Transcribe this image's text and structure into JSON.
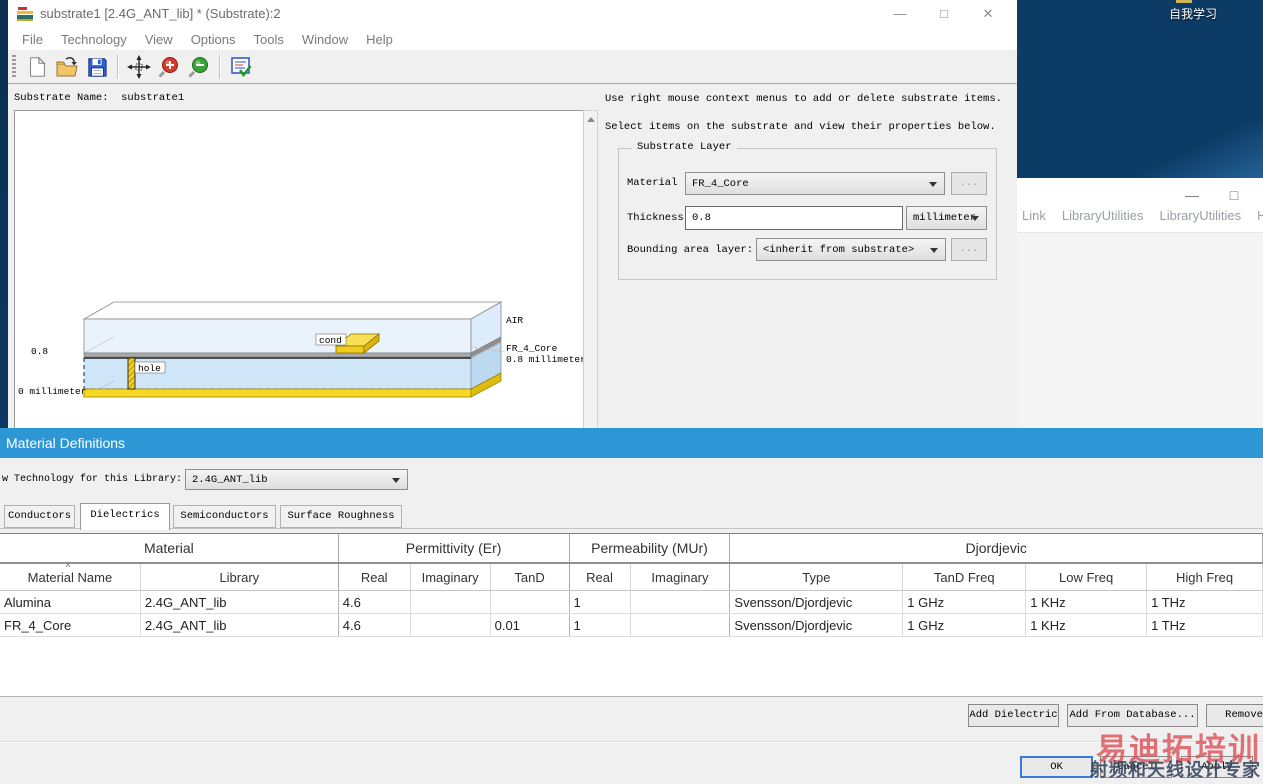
{
  "colors": {
    "dialog_titlebar": "#2d96d5",
    "desktop_blue_dark": "#0c3b66",
    "desktop_blue_light": "#2e6fa8",
    "focus_accent": "#3a7bd5",
    "watermark_red": "#db5058",
    "trace_yellow": "#f6d42e",
    "layer_blue": "#d6e9fb"
  },
  "desktop": {
    "icon_label": "自我学习"
  },
  "background_window": {
    "menus": [
      "Link",
      "LibraryUtilities",
      "LibraryUtilities",
      "He"
    ]
  },
  "substrate_window": {
    "title": "substrate1 [2.4G_ANT_lib] * (Substrate):2",
    "menus": [
      "File",
      "Technology",
      "View",
      "Options",
      "Tools",
      "Window",
      "Help"
    ],
    "toolbar_icons": [
      "new-file",
      "open",
      "save",
      "pan",
      "zoom-in",
      "zoom-out",
      "substrate-check"
    ],
    "substrate_name_label": "Substrate Name:",
    "substrate_name_value": "substrate1",
    "hints": [
      "Use right mouse context menus to add or delete substrate items.",
      "Select items on the substrate and view their properties below."
    ],
    "layer_group": {
      "title": "Substrate Layer",
      "material_label": "Material",
      "material_value": "FR_4_Core",
      "material_browse": "...",
      "thickness_label": "Thickness",
      "thickness_value": "0.8",
      "thickness_unit": "millimeter",
      "bounding_label": "Bounding area layer:",
      "bounding_value": "<inherit from substrate>",
      "bounding_browse": "..."
    },
    "preview_labels": {
      "air": "AIR",
      "cond": "cond",
      "hole": "hole",
      "top_height": "0.8",
      "core_name": "FR_4_Core",
      "core_height": "0.8 millimeter",
      "zero": "0 millimeter"
    }
  },
  "material_dialog": {
    "title": "Material Definitions",
    "technology_label": "w Technology for this Library:",
    "technology_value": "2.4G_ANT_lib",
    "tabs": [
      "Conductors",
      "Dielectrics",
      "Semiconductors",
      "Surface Roughness"
    ],
    "active_tab": "Dielectrics",
    "table": {
      "groups": [
        {
          "label": "Material",
          "cols": 2
        },
        {
          "label": "Permittivity (Er)",
          "cols": 3
        },
        {
          "label": "Permeability (MUr)",
          "cols": 2
        },
        {
          "label": "Djordjevic",
          "cols": 4
        }
      ],
      "columns": [
        "Material Name",
        "Library",
        "Real",
        "Imaginary",
        "TanD",
        "Real",
        "Imaginary",
        "Type",
        "TanD Freq",
        "Low Freq",
        "High Freq"
      ],
      "sort_column_index": 0,
      "rows": [
        [
          "Alumina",
          "2.4G_ANT_lib",
          "4.6",
          "",
          "",
          "1",
          "",
          "Svensson/Djordjevic",
          "1 GHz",
          "1 KHz",
          "1 THz"
        ],
        [
          "FR_4_Core",
          "2.4G_ANT_lib",
          "4.6",
          "",
          "0.01",
          "1",
          "",
          "Svensson/Djordjevic",
          "1 GHz",
          "1 KHz",
          "1 THz"
        ]
      ]
    },
    "action_buttons": [
      "Add Dielectric",
      "Add From Database...",
      "Remove Di"
    ],
    "ok_label": "OK",
    "cancel_label": "Cancel",
    "apply_label": "Apply"
  },
  "watermark": {
    "line1": "易迪拓培训",
    "line2": "射频和天线设计专家"
  }
}
